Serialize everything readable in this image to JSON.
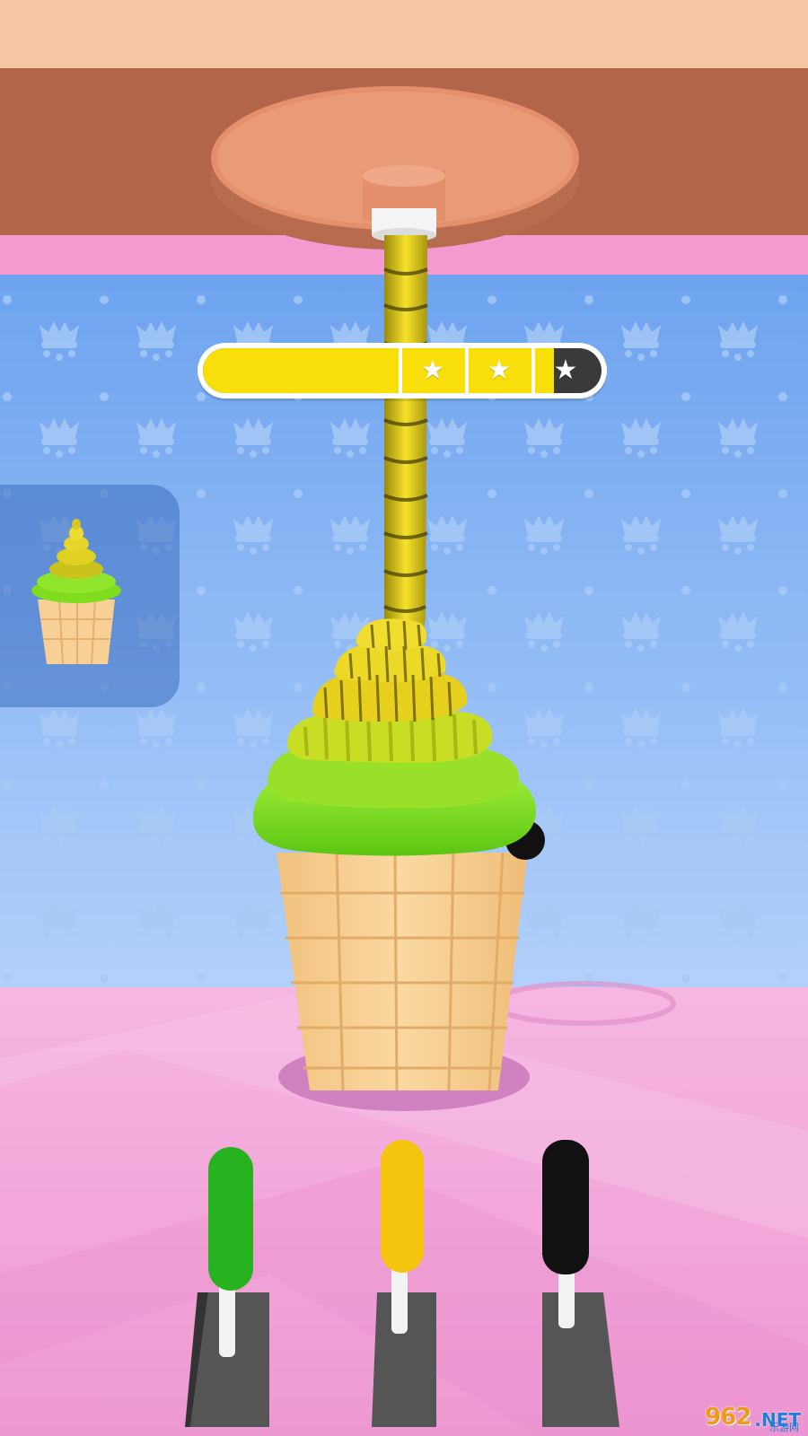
{
  "scene": {
    "colors": {
      "ceiling": "#f6c7a5",
      "wall_upper": "#b3654a",
      "wall_pink": "#f49ad0",
      "wallpaper": "#89b8f4",
      "floor": "#f2a3d8",
      "dispenser_plate": "#e4906c",
      "cone": "#f8cf94"
    }
  },
  "progress": {
    "fraction": 0.88,
    "star_1": "★",
    "star_2": "★",
    "star_3": "★",
    "stars_earned": 2,
    "stars_total": 3,
    "fill_color": "#f8df0a"
  },
  "target_preview": {
    "description_icon": "ice-cream-target-icon",
    "layers": [
      "green",
      "yellow"
    ]
  },
  "levers": [
    {
      "color_name": "green",
      "color": "#27b21f"
    },
    {
      "color_name": "yellow",
      "color": "#f5c40f"
    },
    {
      "color_name": "black",
      "color": "#111111"
    }
  ],
  "watermark": {
    "brand": "962",
    "suffix": ".NET",
    "subtitle": "乐游网"
  }
}
